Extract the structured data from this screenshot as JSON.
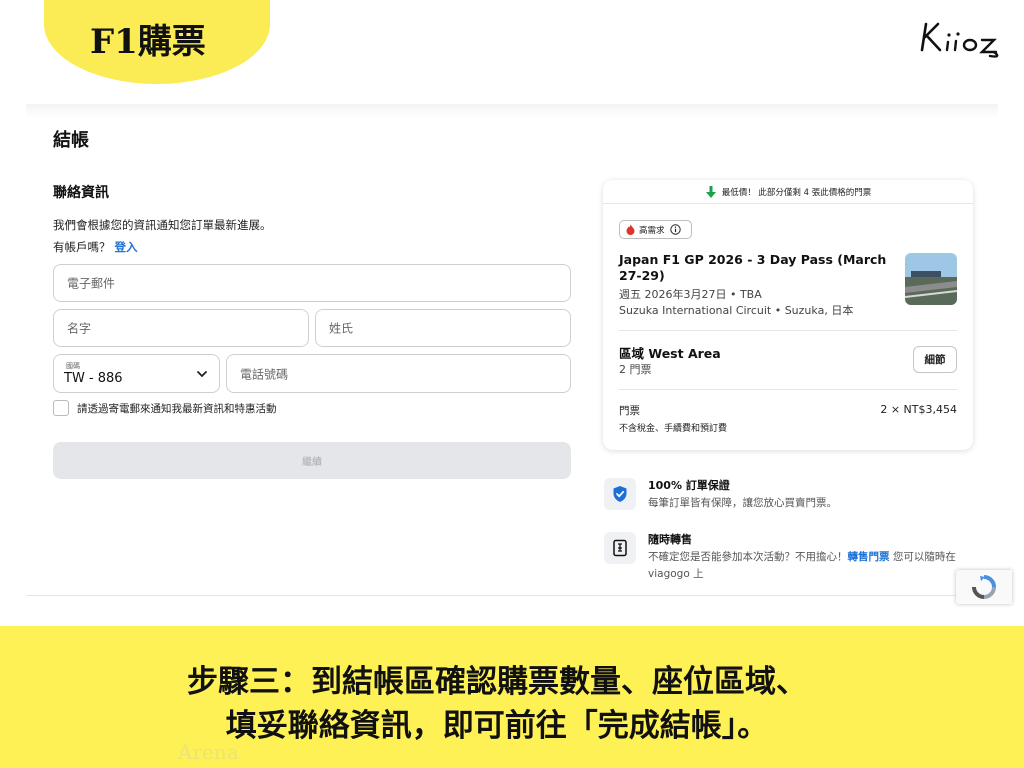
{
  "badge": {
    "title": "F1購票"
  },
  "logo": {
    "text": "Kiioz"
  },
  "checkout": {
    "title": "結帳",
    "section_title": "聯絡資訊",
    "notice": "我們會根據您的資訊通知您訂單最新進展。",
    "account_question": "有帳戶嗎？",
    "login_link": "登入",
    "fields": {
      "email_placeholder": "電子郵件",
      "first_name_placeholder": "名字",
      "last_name_placeholder": "姓氏",
      "country_label": "國碼",
      "country_value": "TW - 886",
      "phone_placeholder": "電話號碼"
    },
    "optin_label": "請透過寄電郵來通知我最新資訊和特惠活動",
    "continue_label": "繼續"
  },
  "summary": {
    "banner": "最低價！ 此部分僅剩 4 張此價格的門票",
    "demand_tag": "高需求",
    "event_name": "Japan F1 GP 2026 - 3 Day Pass (March 27-29)",
    "event_date": "週五 2026年3月27日 • TBA",
    "event_venue": "Suzuka International Circuit • Suzuka, 日本",
    "area": "區域 West Area",
    "area_tickets": "2 門票",
    "details_button": "細節",
    "tickets_label": "門票",
    "tickets_note": "不含稅金、手續費和預訂費",
    "tickets_price": "2 × NT$3,454"
  },
  "features": {
    "guarantee_title": "100% 訂單保證",
    "guarantee_desc": "每筆訂單皆有保障，讓您放心買賣門票。",
    "resale_title": "隨時轉售",
    "resale_desc_1": "不確定您是否能參加本次活動？不用擔心！",
    "resale_link": "轉售門票",
    "resale_desc_2": " 您可以隨時在 viagogo 上"
  },
  "caption": {
    "line1": "步驟三：到結帳區確認購票數量、座位區域、",
    "line2": "填妥聯絡資訊，即可前往「完成結帳」。"
  },
  "ghost_text": "Arena",
  "colors": {
    "accent_yellow": "#fdf155",
    "link_blue": "#1d74d8",
    "button_disabled": "#e4e6e9"
  }
}
